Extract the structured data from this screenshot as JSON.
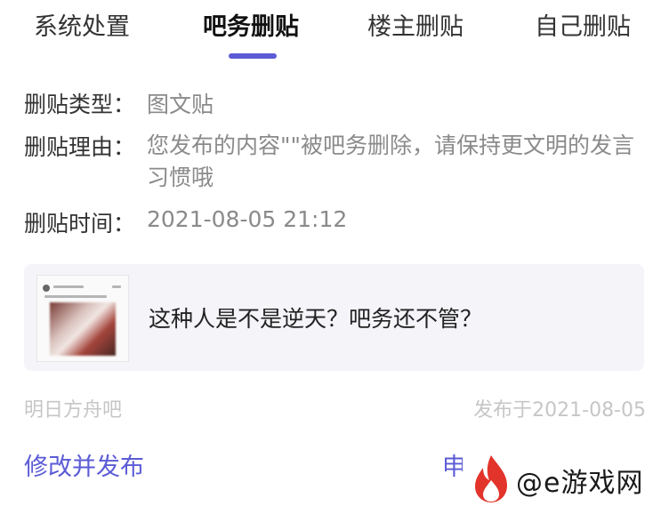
{
  "tabs": [
    {
      "label": "系统处置",
      "active": false
    },
    {
      "label": "吧务删贴",
      "active": true
    },
    {
      "label": "楼主删贴",
      "active": false
    },
    {
      "label": "自己删贴",
      "active": false
    }
  ],
  "details": {
    "type_label": "删贴类型：",
    "type_value": "图文贴",
    "reason_label": "删贴理由：",
    "reason_value": "您发布的内容\"\"被吧务删除，请保持更文明的发言习惯哦",
    "time_label": "删贴时间：",
    "time_value": "2021-08-05 21:12"
  },
  "post": {
    "title": "这种人是不是逆天？吧务还不管？",
    "forum": "明日方舟吧",
    "published": "发布于2021-08-05"
  },
  "actions": {
    "edit_label": "修改并发布",
    "appeal_label": "申"
  },
  "watermark": {
    "text": "@e游戏网"
  },
  "colors": {
    "accent": "#5b5bd6",
    "muted": "#8a8a8a",
    "card_bg": "#f4f4f9",
    "watermark_flame": "#e2342b"
  }
}
